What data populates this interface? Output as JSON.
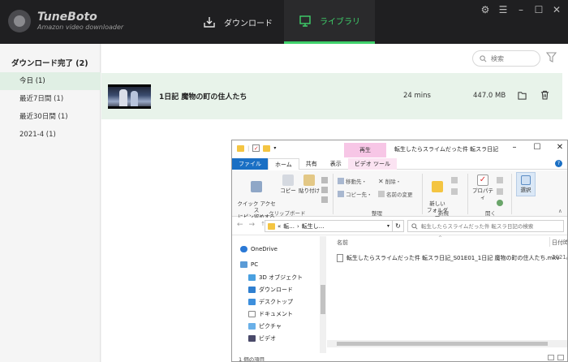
{
  "app": {
    "name": "TuneBoto",
    "subtitle": "Amazon video downloader"
  },
  "nav": {
    "download_label": "ダウンロード",
    "library_label": "ライブラリ"
  },
  "sidebar": {
    "header": "ダウンロード完了 (2)",
    "items": [
      {
        "label": "今日 (1)",
        "active": true
      },
      {
        "label": "最近7日間 (1)"
      },
      {
        "label": "最近30日間 (1)"
      },
      {
        "label": "2021-4 (1)"
      }
    ]
  },
  "search": {
    "placeholder": "検索"
  },
  "library": {
    "rows": [
      {
        "title": "1日記 魔物の町の住人たち",
        "duration": "24 mins",
        "size": "447.0 MB"
      }
    ]
  },
  "explorer": {
    "context_tab": "再生",
    "window_title": "転生したらスライムだった件 転スラ日記",
    "tabs": [
      "ファイル",
      "ホーム",
      "共有",
      "表示",
      "ビデオ ツール"
    ],
    "ribbon": {
      "pin_label": "クイック アクセス\nにピン留めする",
      "copy_label": "コピー",
      "paste_label": "貼り付け",
      "clipboard_group": "クリップボード",
      "move_label": "移動先・",
      "copy_to_label": "コピー先・",
      "delete_label": "削除・",
      "rename_label": "名前の変更",
      "organize_group": "整理",
      "new_folder_label": "新しい\nフォルダー",
      "new_group": "新規",
      "properties_label": "プロパティ",
      "open_group": "開く",
      "select_label": "選択"
    },
    "address": {
      "crumb1": "転...",
      "crumb2": "転生し..."
    },
    "search_placeholder": "転生したらスライムだった件 転スラ日記の検索",
    "nav_items": [
      "OneDrive",
      "PC",
      "3D オブジェクト",
      "ダウンロード",
      "デスクトップ",
      "ドキュメント",
      "ピクチャ",
      "ビデオ"
    ],
    "columns": {
      "name": "名前",
      "date": "日付時"
    },
    "file": {
      "name": "転生したらスライムだった件 転スラ日記_S01E01_1日記 魔物の町の住人たち.mkv",
      "date": "2021/0"
    },
    "status": "1 個の項目"
  },
  "colors": {
    "accent": "#3fd16b",
    "topbar": "#1f1f21",
    "selected_row": "#e8f3ea"
  }
}
